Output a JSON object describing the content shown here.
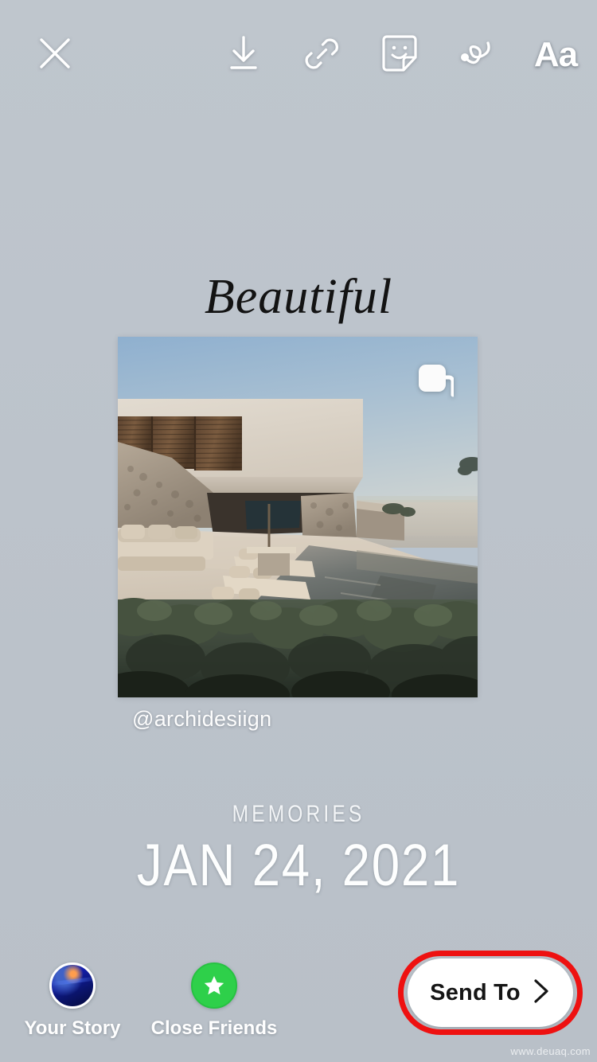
{
  "screen": {
    "app": "Instagram Story Editor",
    "background_color": "#bcc3cb"
  },
  "toolbar": {
    "close_label": "Close",
    "close_icon": "close-x-icon",
    "actions": [
      {
        "name": "save-download",
        "icon": "download-icon",
        "label": "Save"
      },
      {
        "name": "link",
        "icon": "link-chain-icon",
        "label": "Link"
      },
      {
        "name": "sticker",
        "icon": "sticker-smiley-icon",
        "label": "Sticker"
      },
      {
        "name": "draw",
        "icon": "draw-squiggle-icon",
        "label": "Draw"
      },
      {
        "name": "text",
        "icon": "text-aa-icon",
        "label": "Aa"
      }
    ]
  },
  "story": {
    "title": "Beautiful",
    "handle": "@archidesiign",
    "carousel_icon": "multiple-photos-icon",
    "memories_label": "MEMORIES",
    "memories_date": "JAN 24, 2021",
    "photo_alt": "Modern stone and concrete villa with infinity pool overlooking the sea"
  },
  "bottom_bar": {
    "audience": [
      {
        "name": "your-story",
        "label": "Your Story",
        "icon": "user-avatar"
      },
      {
        "name": "close-friends",
        "label": "Close Friends",
        "icon": "green-star-badge",
        "color": "#2ed04a"
      }
    ],
    "send": {
      "label": "Send To",
      "icon": "chevron-right-icon",
      "highlight_color": "#ee1111"
    }
  },
  "watermark": {
    "text": "www.deuaq.com"
  }
}
